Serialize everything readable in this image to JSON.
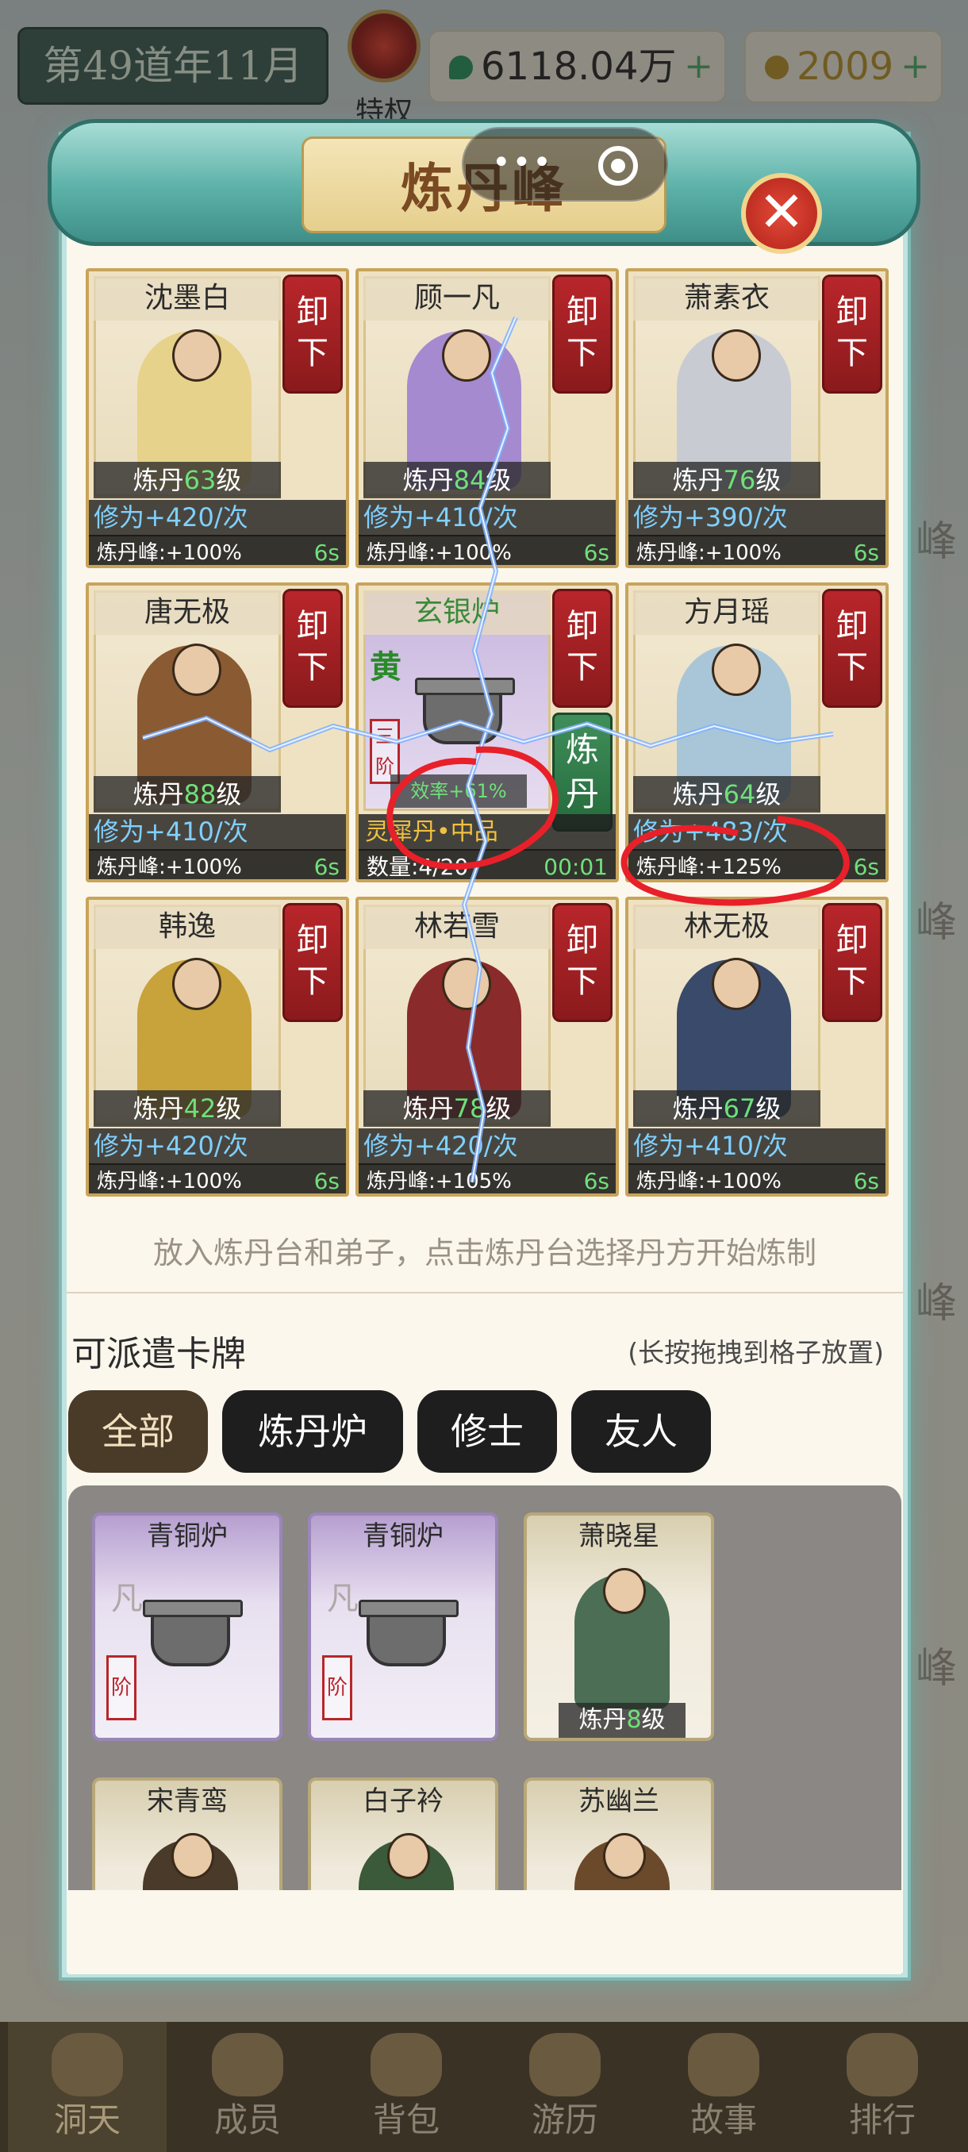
{
  "topbar": {
    "date": "第49道年11月",
    "privilege_label": "特权",
    "spirit_stones": "6118.04万",
    "spirit_plus": "+",
    "gold": "2009",
    "gold_plus": "+",
    "spirit_icon": "jade-stone-icon",
    "gold_icon": "gold-nugget-icon"
  },
  "panel": {
    "title": "炼丹峰",
    "close_icon": "close-icon"
  },
  "slots": [
    {
      "name": "沈墨白",
      "unload": "卸下",
      "level_prefix": "炼丹",
      "level": "63",
      "level_suffix": "级",
      "gain": "修为+420/次",
      "bonus": "炼丹峰:+100%",
      "timer": "6s"
    },
    {
      "name": "顾一凡",
      "unload": "卸下",
      "level_prefix": "炼丹",
      "level": "84",
      "level_suffix": "级",
      "gain": "修为+410/次",
      "bonus": "炼丹峰:+100%",
      "timer": "6s"
    },
    {
      "name": "萧素衣",
      "unload": "卸下",
      "level_prefix": "炼丹",
      "level": "76",
      "level_suffix": "级",
      "gain": "修为+390/次",
      "bonus": "炼丹峰:+100%",
      "timer": "6s"
    },
    {
      "name": "唐无极",
      "unload": "卸下",
      "level_prefix": "炼丹",
      "level": "88",
      "level_suffix": "级",
      "gain": "修为+410/次",
      "bonus": "炼丹峰:+100%",
      "timer": "6s"
    },
    {
      "name": "方月瑶",
      "unload": "卸下",
      "level_prefix": "炼丹",
      "level": "64",
      "level_suffix": "级",
      "gain": "修为+483/次",
      "bonus": "炼丹峰:+125%",
      "timer": "6s"
    },
    {
      "name": "韩逸",
      "unload": "卸下",
      "level_prefix": "炼丹",
      "level": "42",
      "level_suffix": "级",
      "gain": "修为+420/次",
      "bonus": "炼丹峰:+100%",
      "timer": "6s"
    },
    {
      "name": "林若雪",
      "unload": "卸下",
      "level_prefix": "炼丹",
      "level": "78",
      "level_suffix": "级",
      "gain": "修为+420/次",
      "bonus": "炼丹峰:+105%",
      "timer": "6s"
    },
    {
      "name": "林无极",
      "unload": "卸下",
      "level_prefix": "炼丹",
      "level": "67",
      "level_suffix": "级",
      "gain": "修为+410/次",
      "bonus": "炼丹峰:+100%",
      "timer": "6s"
    }
  ],
  "furnace": {
    "name": "玄银炉",
    "grade": "黄",
    "tier": "三阶",
    "unload": "卸下",
    "refine": "炼丹",
    "efficiency": "效率+61%",
    "pill": "灵犀丹•中品",
    "quantity": "数量:4/20",
    "timer": "00:01"
  },
  "hint": "放入炼丹台和弟子，点击炼丹台选择丹方开始炼制",
  "deploy": {
    "title": "可派遣卡牌",
    "hint": "(长按拖拽到格子放置)",
    "filters": [
      "全部",
      "炼丹炉",
      "修士",
      "友人"
    ],
    "cards": [
      {
        "name": "青铜炉",
        "kind": "furnace",
        "grade": "凡",
        "tier": "阶"
      },
      {
        "name": "青铜炉",
        "kind": "furnace",
        "grade": "凡",
        "tier": "阶"
      },
      {
        "name": "萧晓星",
        "kind": "disciple",
        "level_prefix": "炼丹",
        "level": "8",
        "level_suffix": "级"
      },
      {
        "name": "宋青鸾",
        "kind": "disciple"
      },
      {
        "name": "白子衿",
        "kind": "disciple"
      },
      {
        "name": "苏幽兰",
        "kind": "disciple"
      }
    ]
  },
  "nav": [
    "洞天",
    "成员",
    "背包",
    "游历",
    "故事",
    "排行"
  ],
  "background": {
    "peak_label": "峰"
  },
  "colors": {
    "accent_teal": "#5bb1a8",
    "unload_red": "#b8262a",
    "refine_green": "#3f8f5a",
    "level_green": "#6fe07a",
    "annotation_red": "#e8202a",
    "lightning_blue": "#6fa8ff"
  }
}
